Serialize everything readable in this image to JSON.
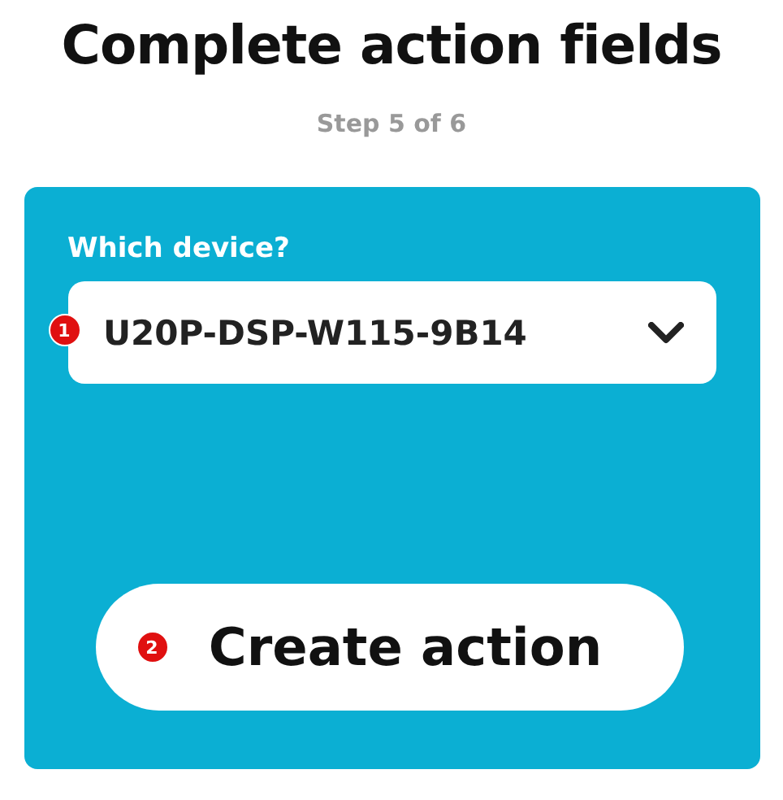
{
  "title": "Complete action fields",
  "step": "Step 5 of 6",
  "form": {
    "label": "Which device?",
    "select": {
      "value": "U20P-DSP-W115-9B14",
      "marker": "1"
    },
    "button": {
      "label": "Create action",
      "marker": "2"
    }
  }
}
